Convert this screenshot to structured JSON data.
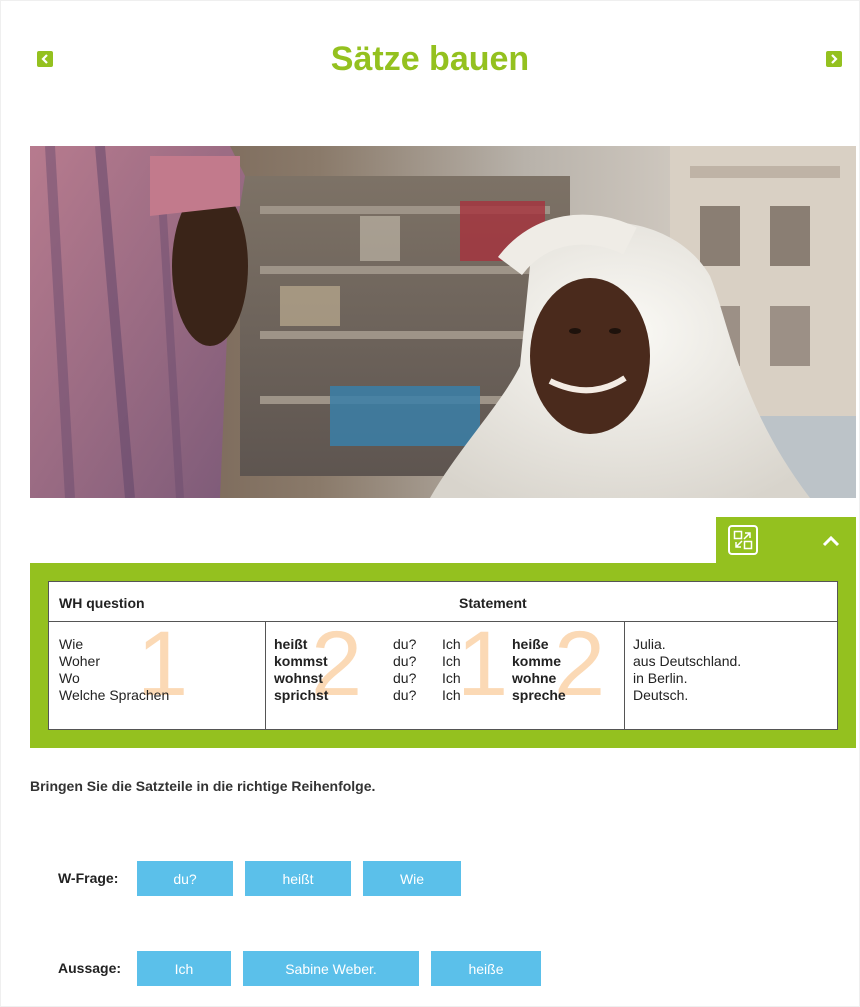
{
  "header": {
    "title": "Sätze bauen",
    "prev_icon": "chevron-left-icon",
    "next_icon": "chevron-right-icon"
  },
  "colors": {
    "accent": "#94c11f",
    "chip": "#5bc0ea",
    "number_watermark": "#fbd9b5"
  },
  "grammar": {
    "expand_icon": "expand-icon",
    "collapse_icon": "chevron-up-icon",
    "headers": {
      "wh_question": "WH question",
      "statement": "Statement"
    },
    "numbers": [
      "1",
      "2",
      "1",
      "2"
    ],
    "rows": [
      {
        "w": "Wie",
        "verb": "heißt",
        "pron": "du?",
        "ich": "Ich",
        "verb2": "heiße",
        "rest": "Julia."
      },
      {
        "w": "Woher",
        "verb": "kommst",
        "pron": "du?",
        "ich": "Ich",
        "verb2": "komme",
        "rest": "aus Deutschland."
      },
      {
        "w": "Wo",
        "verb": "wohnst",
        "pron": "du?",
        "ich": "Ich",
        "verb2": "wohne",
        "rest": "in Berlin."
      },
      {
        "w": "Welche Sprachen",
        "verb": "sprichst",
        "pron": "du?",
        "ich": "Ich",
        "verb2": "spreche",
        "rest": "Deutsch."
      }
    ]
  },
  "exercise": {
    "instruction": "Bringen Sie die Satzteile in die richtige Reihenfolge.",
    "wfrage": {
      "label": "W-Frage:",
      "chips": [
        "du?",
        "heißt",
        "Wie"
      ]
    },
    "aussage": {
      "label": "Aussage:",
      "chips": [
        "Ich",
        "Sabine Weber.",
        "heiße"
      ]
    }
  }
}
